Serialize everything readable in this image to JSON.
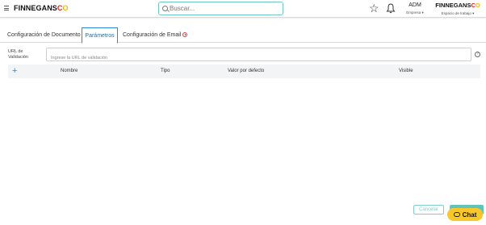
{
  "header": {
    "brand": "FINNEGANS",
    "brand_suffix_a": "C",
    "brand_suffix_b": "O",
    "search_placeholder": "Buscar...",
    "user_code": "ADM",
    "user_label": "Empresa ▾",
    "workspace_brand": "FINNEGANS",
    "workspace_label": "Espacio de trabajo ▾"
  },
  "tabs": [
    {
      "label": "Configuración de Documento"
    },
    {
      "label": "Parámetros",
      "active": true
    },
    {
      "label": "Configuración de Email"
    }
  ],
  "url_field": {
    "label": "URL de Validación",
    "placeholder": "Ingrese la URL de validación",
    "help": "?"
  },
  "table": {
    "add_label": "+",
    "columns": [
      "Nombre",
      "Tipo",
      "Valor por defecto",
      "Visible"
    ]
  },
  "footer": {
    "cancel_label": "Cancelar",
    "chat_label": "Chat"
  },
  "colors": {
    "accent": "#2a8bd8",
    "teal": "#5ec4bd",
    "chat": "#f8c82a",
    "alert": "#d43a3a"
  }
}
